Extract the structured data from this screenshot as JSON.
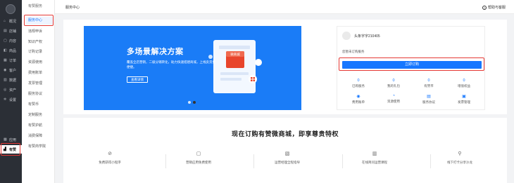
{
  "rail": {
    "items": [
      {
        "label": "概况",
        "icon": "home-icon"
      },
      {
        "label": "店铺",
        "icon": "store-icon"
      },
      {
        "label": "内容",
        "icon": "content-icon"
      },
      {
        "label": "商品",
        "icon": "goods-icon"
      },
      {
        "label": "订单",
        "icon": "order-icon"
      },
      {
        "label": "客户",
        "icon": "customer-icon"
      },
      {
        "label": "数据",
        "icon": "data-icon"
      },
      {
        "label": "资产",
        "icon": "asset-icon"
      },
      {
        "label": "设置",
        "icon": "settings-icon"
      },
      {
        "label": "应用",
        "icon": "apps-icon"
      },
      {
        "label": "有赞",
        "icon": "youzan-icon"
      }
    ]
  },
  "submenu": {
    "header": "有赞服务",
    "items": [
      "服务中心",
      "违规申诉",
      "知识产权",
      "订购记录",
      "资源使用",
      "费用账单",
      "发票管理",
      "服务协议",
      "有赞币",
      "定制服务",
      "有赞护航",
      "消费保障",
      "有赞商学院"
    ]
  },
  "topbar": {
    "title": "服务中心",
    "help": "帮助与客服"
  },
  "banner": {
    "title": "多场景解决方案",
    "subtitle": "覆盖全店营销，二级分销转化，助力快速搭建商城，上线卖货更便捷。",
    "button": "查看详情",
    "card_label": "微商城"
  },
  "account": {
    "name": "头条字字210405",
    "status": "您暂未订购服务",
    "order_button": "立即订购",
    "stats": [
      {
        "value": "0",
        "label": "已购服务"
      },
      {
        "value": "0",
        "label": "我的礼包"
      },
      {
        "value": "0",
        "label": "有赞币"
      },
      {
        "value": "0",
        "label": "增值权益"
      }
    ],
    "quick_links": [
      {
        "label": "费用账单",
        "icon": "bill-icon"
      },
      {
        "label": "资源使用",
        "icon": "resource-icon"
      },
      {
        "label": "服务协议",
        "icon": "agreement-icon"
      },
      {
        "label": "发票管理",
        "icon": "invoice-icon"
      }
    ]
  },
  "promo": {
    "heading": "现在订购有赞微商城，即享尊贵特权",
    "features": [
      {
        "label": "免费获得小程序",
        "icon": "miniprogram-icon"
      },
      {
        "label": "营销应用免费使用",
        "icon": "marketing-icon"
      },
      {
        "label": "运营经理全程指导",
        "icon": "manager-icon"
      },
      {
        "label": "在线简问运营课程",
        "icon": "course-icon"
      },
      {
        "label": "线下打卡分享沙龙",
        "icon": "location-icon"
      }
    ]
  },
  "colors": {
    "accent": "#1677ff",
    "banner": "#1a7cf7",
    "highlight": "#e53935",
    "rail": "#2b2f36"
  }
}
